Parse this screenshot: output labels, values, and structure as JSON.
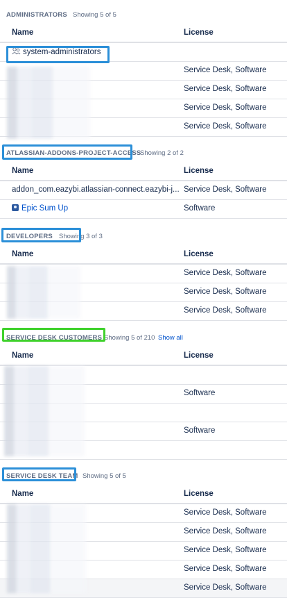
{
  "sections": [
    {
      "title": "ADMINISTRATORS",
      "count": "Showing 5 of 5",
      "col_name": "Name",
      "col_license": "License",
      "rows": [
        {
          "name": "system-administrators",
          "license": ""
        },
        {
          "name": "",
          "license": "Service Desk, Software"
        },
        {
          "name": "",
          "license": "Service Desk, Software"
        },
        {
          "name": "",
          "license": "Service Desk, Software"
        },
        {
          "name": "",
          "license": "Service Desk, Software"
        }
      ]
    },
    {
      "title": "ATLASSIAN-ADDONS-PROJECT-ACCESS",
      "count": "Showing 2 of 2",
      "col_name": "Name",
      "col_license": "License",
      "rows": [
        {
          "name": "addon_com.eazybi.atlassian-connect.eazybi-j...",
          "license": "Service Desk, Software"
        },
        {
          "name": "Epic Sum Up",
          "license": "Software"
        }
      ]
    },
    {
      "title": "DEVELOPERS",
      "count": "Showing 3 of 3",
      "col_name": "Name",
      "col_license": "License",
      "rows": [
        {
          "name": "",
          "license": "Service Desk, Software"
        },
        {
          "name": "",
          "license": "Service Desk, Software"
        },
        {
          "name": "",
          "license": "Service Desk, Software"
        }
      ]
    },
    {
      "title": "SERVICE DESK CUSTOMERS",
      "count": "Showing 5 of 210",
      "show_all": "Show all",
      "col_name": "Name",
      "col_license": "License",
      "rows": [
        {
          "name": "",
          "license": ""
        },
        {
          "name": "",
          "license": "Software"
        },
        {
          "name": "",
          "license": ""
        },
        {
          "name": "",
          "license": "Software"
        },
        {
          "name": "",
          "license": ""
        }
      ]
    },
    {
      "title": "SERVICE DESK TEAM",
      "count": "Showing 5 of 5",
      "col_name": "Name",
      "col_license": "License",
      "rows": [
        {
          "name": "",
          "license": "Service Desk, Software"
        },
        {
          "name": "",
          "license": "Service Desk, Software"
        },
        {
          "name": "",
          "license": "Service Desk, Software"
        },
        {
          "name": "",
          "license": "Service Desk, Software"
        },
        {
          "name": "",
          "license": "Service Desk, Software"
        }
      ]
    }
  ],
  "colors": {
    "highlight_blue": "#2b8fd8",
    "highlight_green": "#3fd12c",
    "link": "#0052cc"
  }
}
